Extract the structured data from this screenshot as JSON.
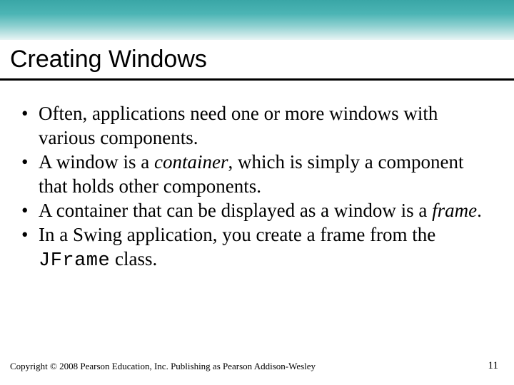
{
  "slide": {
    "title": "Creating Windows",
    "bullets": [
      {
        "pre": "Often, applications need one or more windows with various components.",
        "em": "",
        "post": ""
      },
      {
        "pre": "A window is a ",
        "em": "container",
        "post": ", which is simply a component that holds other components."
      },
      {
        "pre": "A container that can be displayed as a window is a ",
        "em": "frame",
        "post": "."
      },
      {
        "pre": "In a Swing application, you create a frame from the ",
        "code": "JFrame",
        "post": " class."
      }
    ],
    "footer": "Copyright © 2008 Pearson Education, Inc. Publishing as Pearson Addison-Wesley",
    "page": "11"
  }
}
